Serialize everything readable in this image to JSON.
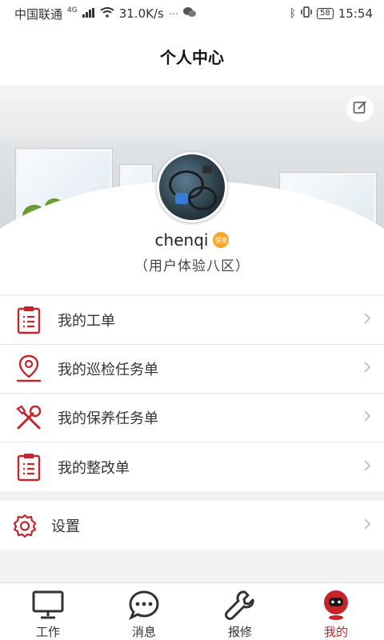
{
  "status_bar": {
    "carrier": "中国联通",
    "network": "4G",
    "speed": "31.0K/s",
    "battery": "58",
    "time": "15:54"
  },
  "header": {
    "title": "个人中心"
  },
  "profile": {
    "username": "chenqi",
    "badge": "保密",
    "area": "（用户体验八区）"
  },
  "menu": {
    "items": [
      {
        "label": "我的工单",
        "icon": "clipboard-list-icon"
      },
      {
        "label": "我的巡检任务单",
        "icon": "location-pin-icon"
      },
      {
        "label": "我的保养任务单",
        "icon": "tools-icon"
      },
      {
        "label": "我的整改单",
        "icon": "clipboard-list-icon"
      }
    ]
  },
  "settings": {
    "label": "设置",
    "icon": "gear-icon"
  },
  "tabbar": {
    "tabs": [
      {
        "label": "工作",
        "icon": "monitor-icon"
      },
      {
        "label": "消息",
        "icon": "chat-bubble-icon"
      },
      {
        "label": "报修",
        "icon": "wrench-icon"
      },
      {
        "label": "我的",
        "icon": "robot-icon"
      }
    ],
    "active": "我的"
  },
  "colors": {
    "accent": "#c5242b",
    "badge": "#f5a623"
  }
}
